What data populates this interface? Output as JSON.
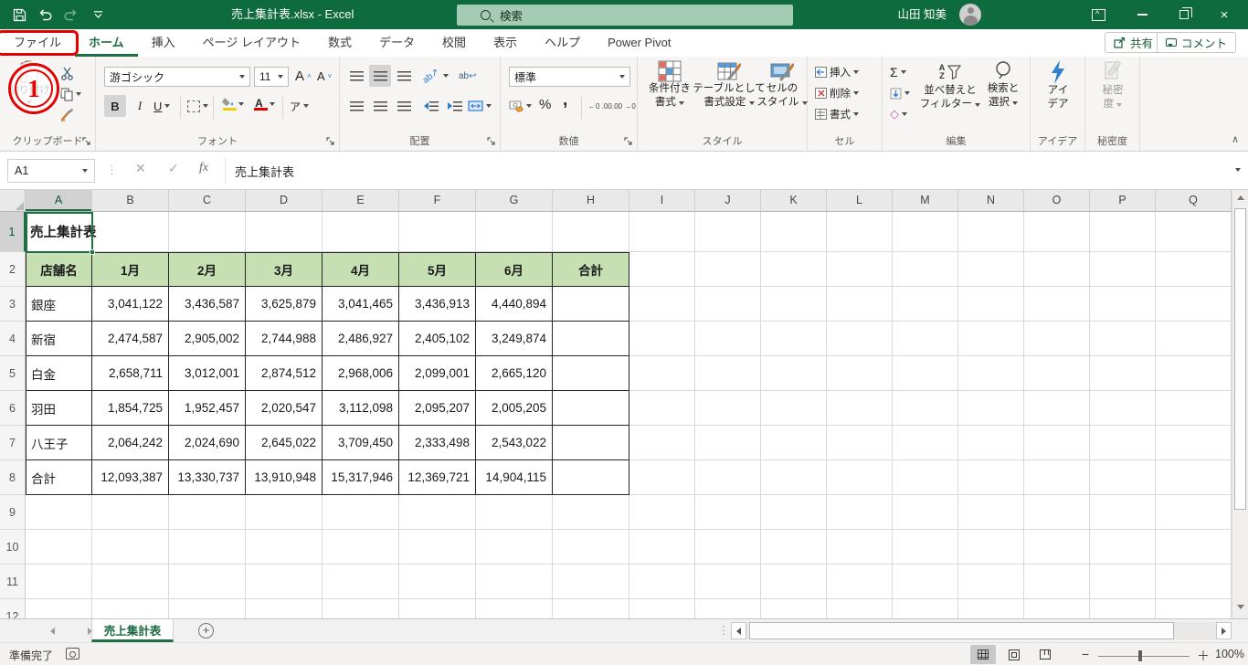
{
  "title_bar": {
    "document_title": "売上集計表.xlsx - Excel",
    "search_placeholder": "検索",
    "user_name": "山田 知美"
  },
  "tab_row": {
    "tabs": [
      "ファイル",
      "ホーム",
      "挿入",
      "ページ レイアウト",
      "数式",
      "データ",
      "校閲",
      "表示",
      "ヘルプ",
      "Power Pivot"
    ],
    "active_tab": "ホーム",
    "file_tab": "ファイル",
    "share_label": "共有",
    "comment_label": "コメント"
  },
  "ribbon": {
    "clipboard": {
      "group_label": "クリップボード",
      "paste_label": "貼り付け"
    },
    "font": {
      "group_label": "フォント",
      "font_name": "游ゴシック",
      "font_size": "11",
      "bold_label": "B",
      "italic_label": "I",
      "underline_label": "U",
      "grow_label": "A",
      "shrink_label": "A",
      "phonetic_label": "ア"
    },
    "alignment": {
      "group_label": "配置",
      "orient_label": "ab",
      "wrap_label": "ab"
    },
    "number": {
      "group_label": "数値",
      "format_value": "標準",
      "percent_label": "%",
      "comma_label": ",",
      "inc_decimal_label": "←0 .00",
      "dec_decimal_label": ".00 →0"
    },
    "styles": {
      "group_label": "スタイル",
      "conditional_line1": "条件付き",
      "conditional_line2": "書式",
      "table_line1": "テーブルとして",
      "table_line2": "書式設定",
      "cell_line1": "セルの",
      "cell_line2": "スタイル"
    },
    "cells": {
      "group_label": "セル",
      "insert_label": "挿入",
      "delete_label": "削除",
      "format_label": "書式"
    },
    "editing": {
      "group_label": "編集",
      "autosum_label": "Σ",
      "az_top": "A",
      "az_bottom": "Z",
      "sort_line1": "並べ替えと",
      "sort_line2": "フィルター",
      "find_line1": "検索と",
      "find_line2": "選択"
    },
    "ideas": {
      "group_label": "アイデア",
      "button_line1": "アイ",
      "button_line2": "デア"
    },
    "sensitivity": {
      "group_label": "秘密度",
      "button_line1": "秘密",
      "button_line2": "度"
    }
  },
  "formula_bar": {
    "name_box": "A1",
    "fx_label": "fx",
    "formula": "売上集計表"
  },
  "sheet": {
    "columns": [
      "A",
      "B",
      "C",
      "D",
      "E",
      "F",
      "G",
      "H",
      "I",
      "J",
      "K",
      "L",
      "M",
      "N",
      "O",
      "P",
      "Q"
    ],
    "row_count": 12,
    "selected_cell": "A1",
    "title_cell_value": "売上集計表",
    "table": {
      "header_row": [
        "店舗名",
        "1月",
        "2月",
        "3月",
        "4月",
        "5月",
        "6月",
        "合計"
      ],
      "data_rows": [
        [
          "銀座",
          "3,041,122",
          "3,436,587",
          "3,625,879",
          "3,041,465",
          "3,436,913",
          "4,440,894"
        ],
        [
          "新宿",
          "2,474,587",
          "2,905,002",
          "2,744,988",
          "2,486,927",
          "2,405,102",
          "3,249,874"
        ],
        [
          "白金",
          "2,658,711",
          "3,012,001",
          "2,874,512",
          "2,968,006",
          "2,099,001",
          "2,665,120"
        ],
        [
          "羽田",
          "1,854,725",
          "1,952,457",
          "2,020,547",
          "3,112,098",
          "2,095,207",
          "2,005,205"
        ],
        [
          "八王子",
          "2,064,242",
          "2,024,690",
          "2,645,022",
          "3,709,450",
          "2,333,498",
          "2,543,022"
        ],
        [
          "合計",
          "12,093,387",
          "13,330,737",
          "13,910,948",
          "15,317,946",
          "12,369,721",
          "14,904,115"
        ]
      ]
    }
  },
  "sheet_tabs": {
    "active_sheet": "売上集計表"
  },
  "status_bar": {
    "mode": "準備完了",
    "zoom_level": "100%"
  },
  "annotations": {
    "step_number": "1"
  },
  "colors": {
    "title_bar_green": "#0e6b3e",
    "accent_green": "#1e7044",
    "table_header_fill": "#c6e0b4",
    "annotation_red": "#e60000"
  }
}
